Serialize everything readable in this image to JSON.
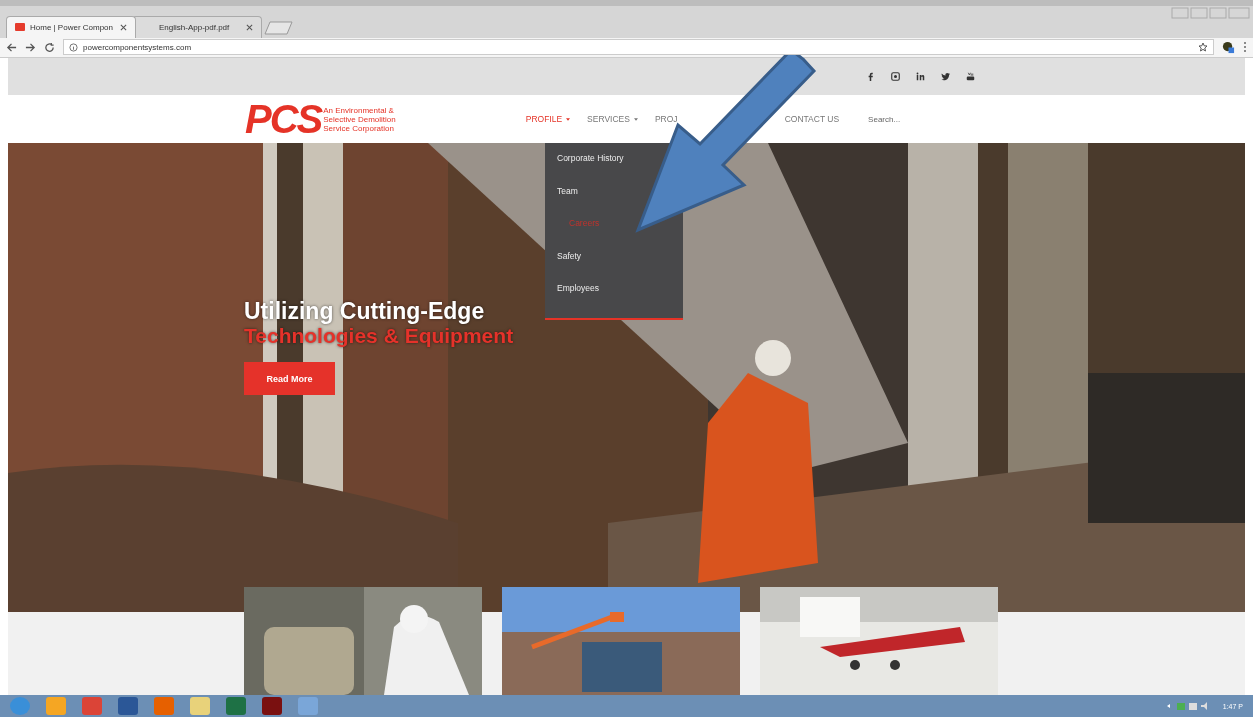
{
  "browser": {
    "tabs": [
      {
        "title": "Home | Power Compon",
        "selected": true
      },
      {
        "title": "English-App-pdf.pdf",
        "selected": false
      }
    ],
    "url": "powercomponentsystems.com"
  },
  "site": {
    "logo": {
      "letters": "PCS",
      "tagline": [
        "An Environmental &",
        "Selective Demolition",
        "Service Corporation"
      ]
    },
    "nav": [
      {
        "label": "PROFILE",
        "dropdown": true,
        "selected": true
      },
      {
        "label": "SERVICES",
        "dropdown": true,
        "selected": false
      },
      {
        "label": "PROJ",
        "dropdown": false,
        "selected": false
      },
      {
        "label": "CONTACT US",
        "dropdown": false,
        "selected": false
      }
    ],
    "search": {
      "placeholder": "Search..."
    },
    "submenu": [
      {
        "label": "Corporate History",
        "selected": false
      },
      {
        "label": "Team",
        "selected": false
      },
      {
        "label": "Careers",
        "selected": true
      },
      {
        "label": "Safety",
        "selected": false
      },
      {
        "label": "Employees",
        "selected": false
      }
    ],
    "hero": {
      "headline": "Utilizing Cutting-Edge",
      "subline": "Technologies & Equipment",
      "button": "Read More"
    }
  },
  "taskbar": {
    "clock": "1:47 P"
  }
}
